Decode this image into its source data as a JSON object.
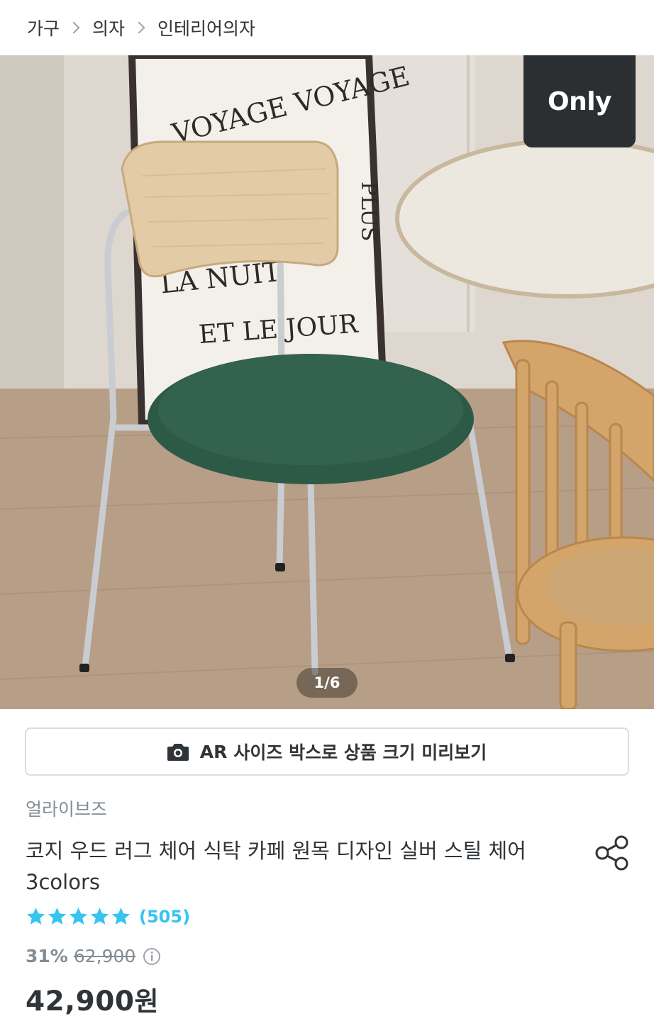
{
  "breadcrumb": [
    "가구",
    "의자",
    "인테리어의자"
  ],
  "hero": {
    "badge": "Only",
    "counter": "1/6",
    "poster_text": [
      "VOYAGE VOYAGE",
      "PLUS",
      "LA NUIT",
      "ET LE JOUR"
    ]
  },
  "ar_button": {
    "prefix": "AR",
    "label": "사이즈 박스로 상품 크기 미리보기"
  },
  "product": {
    "brand": "얼라이브즈",
    "title": "코지 우드 러그 체어 식탁 카페 원목 디자인 실버 스틸 체어 3colors",
    "rating_stars": 5,
    "review_count": "(505)",
    "discount": "31%",
    "original_price": "62,900",
    "price": "42,900",
    "currency": "원"
  },
  "colors": {
    "accent": "#35c5f0",
    "text": "#2f3438",
    "muted": "#828c94",
    "badge_bg": "#2c2f31"
  },
  "icons": [
    "chevron-right-icon",
    "camera-icon",
    "share-icon",
    "star-icon",
    "info-icon"
  ]
}
